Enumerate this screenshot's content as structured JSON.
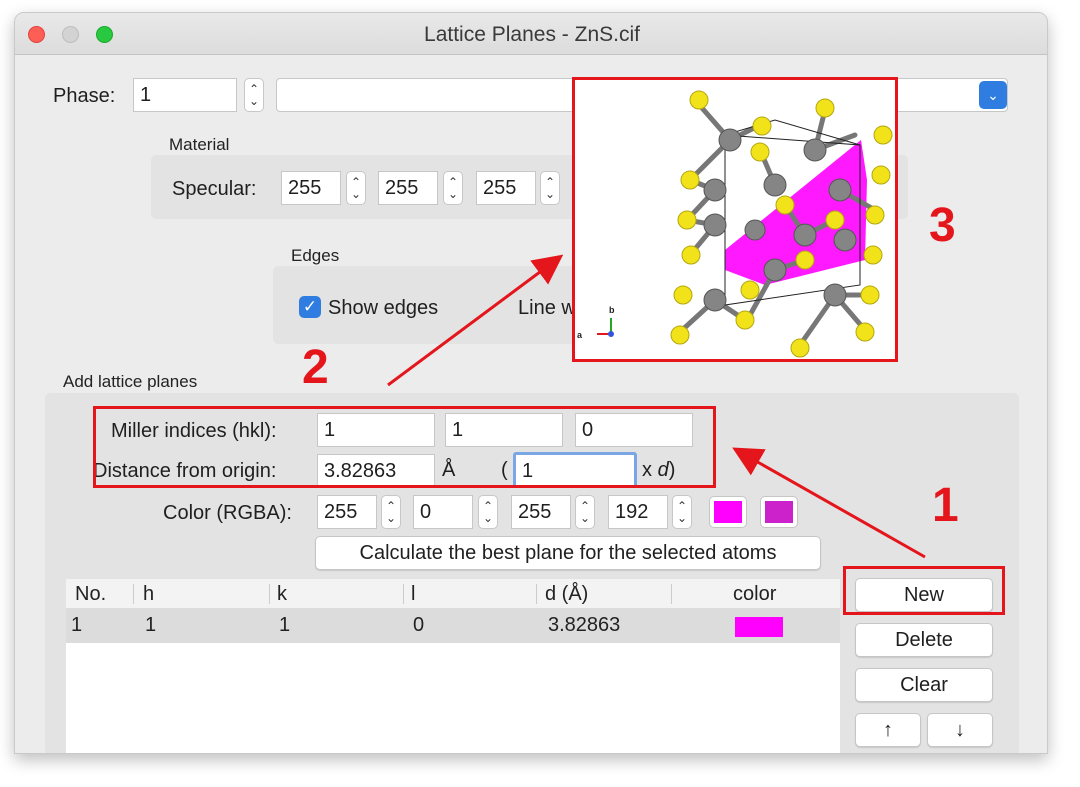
{
  "window": {
    "title": "Lattice Planes - ZnS.cif"
  },
  "phase": {
    "label": "Phase:",
    "value": "1"
  },
  "material": {
    "group_label": "Material",
    "specular_label": "Specular:",
    "specular": [
      "255",
      "255",
      "255"
    ]
  },
  "edges": {
    "group_label": "Edges",
    "show_edges_label": "Show edges",
    "show_edges_checked": true,
    "line_width_label": "Line w"
  },
  "add_planes": {
    "group_label": "Add lattice planes",
    "miller_label": "Miller indices (hkl):",
    "miller": [
      "1",
      "1",
      "0"
    ],
    "distance_label": "Distance from origin:",
    "distance_value": "3.82863",
    "distance_unit": "Å",
    "paren_open": "(",
    "multiplier": "1",
    "multiplier_suffix_x": "x",
    "multiplier_suffix_d": "d",
    "paren_close": ")",
    "color_label": "Color (RGBA):",
    "rgba": [
      "255",
      "0",
      "255",
      "192"
    ],
    "swatch_color": "#ff00ff",
    "swatch2_color": "#cc22cc",
    "calc_button": "Calculate the best plane for the selected atoms"
  },
  "table": {
    "headers": [
      "No.",
      "h",
      "k",
      "l",
      "d (Å)",
      "color"
    ],
    "rows": [
      {
        "no": "1",
        "h": "1",
        "k": "1",
        "l": "0",
        "d": "3.82863",
        "color": "#ff00ff"
      }
    ]
  },
  "buttons": {
    "new": "New",
    "delete": "Delete",
    "clear": "Clear",
    "up": "↑",
    "down": "↓"
  },
  "viewer": {
    "axis_a": "a",
    "axis_b": "b"
  },
  "annotations": {
    "n1": "1",
    "n2": "2",
    "n3": "3"
  },
  "colors": {
    "annotation_red": "#e4151b",
    "plane_magenta": "#ff00ff",
    "atom_yellow": "#f2e21a",
    "atom_gray": "#7a7a7a",
    "checkbox_blue": "#2f7de1"
  }
}
